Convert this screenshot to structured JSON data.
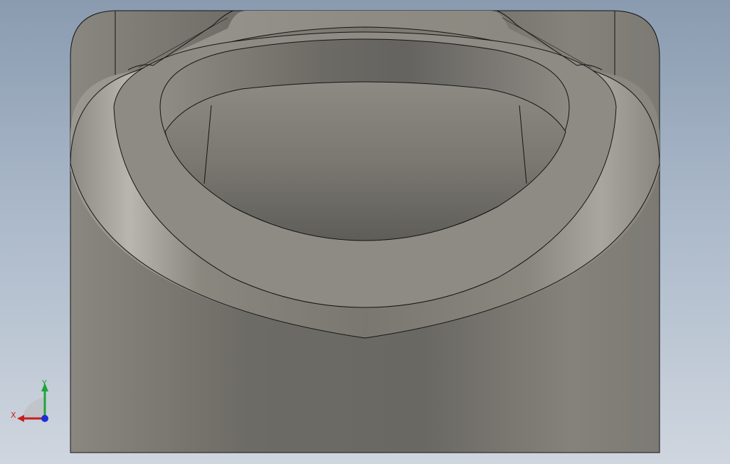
{
  "app": {
    "kind": "cad-3d-viewport"
  },
  "triad": {
    "x_label": "X",
    "y_label": "Y",
    "x_color": "#c81e1e",
    "y_color": "#1fa53a",
    "z_color": "#1c2fd6"
  },
  "colors": {
    "background_top": "#8a9bb0",
    "background_bottom": "#cfd6df",
    "model_body": "#7a7770",
    "model_light": "#9d9a93",
    "edge": "#141414"
  }
}
